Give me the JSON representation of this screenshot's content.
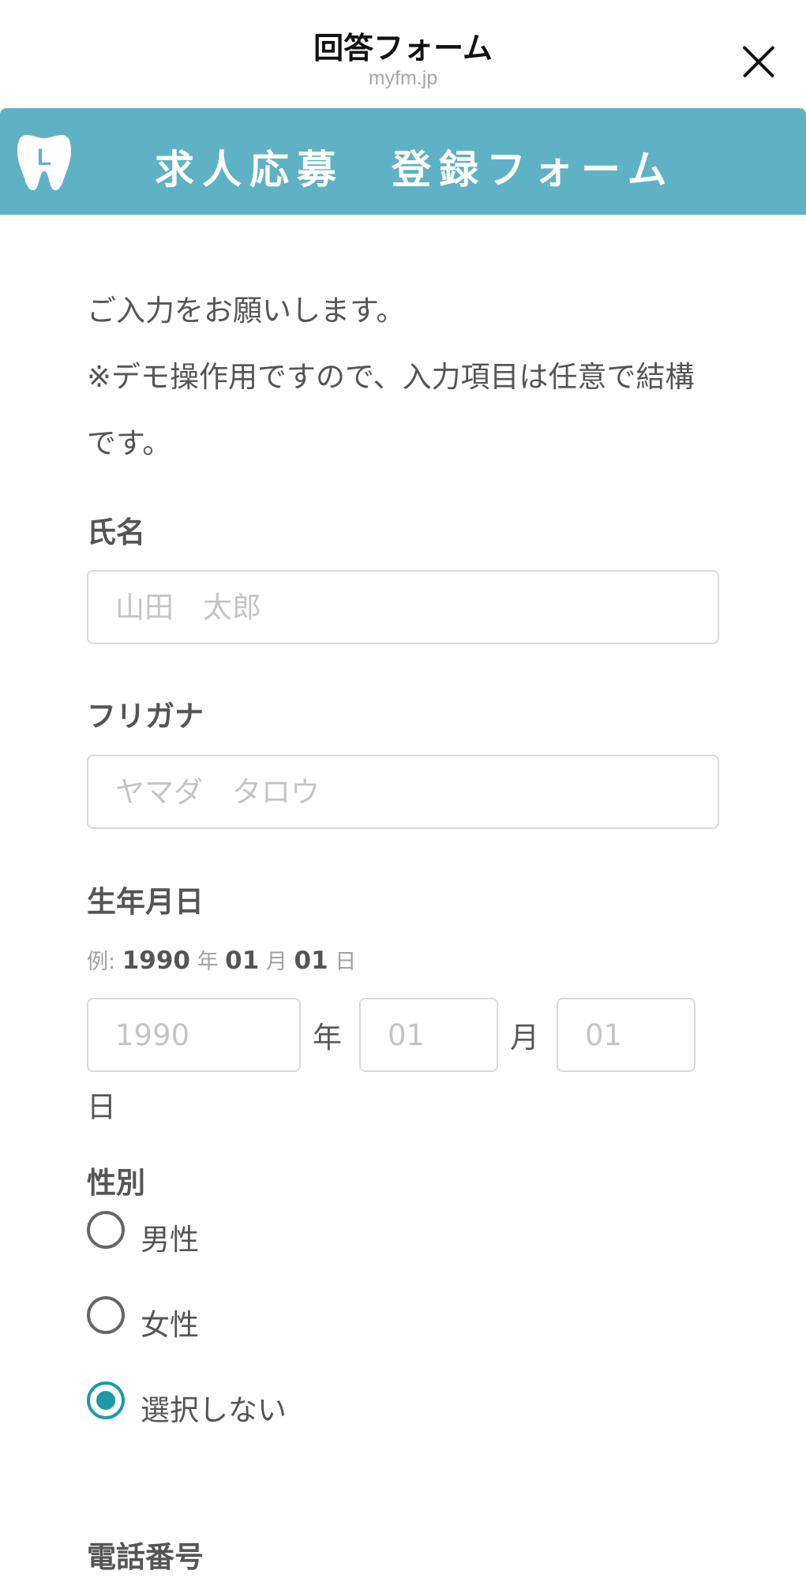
{
  "header": {
    "title": "回答フォーム",
    "domain": "myfm.jp",
    "close_icon": "close-icon"
  },
  "banner": {
    "logo_icon": "tooth-logo-icon",
    "logo_letter": "L",
    "title": "求人応募　登録フォーム",
    "color": "#5fb2c4"
  },
  "intro": {
    "line1": "ご入力をお願いします。",
    "line2": "※デモ操作用ですので、入力項目は任意で結構です。"
  },
  "fields": {
    "name": {
      "label": "氏名",
      "value": "",
      "placeholder": "山田　太郎"
    },
    "furigana": {
      "label": "フリガナ",
      "value": "",
      "placeholder": "ヤマダ　タロウ"
    },
    "birthdate": {
      "label": "生年月日",
      "example_prefix": "例:",
      "example_year": "1990",
      "example_year_unit": "年",
      "example_month": "01",
      "example_month_unit": "月",
      "example_day": "01",
      "example_day_unit": "日",
      "year_placeholder": "1990",
      "month_placeholder": "01",
      "day_placeholder": "01",
      "year_unit": "年",
      "month_unit": "月",
      "day_unit": "日"
    },
    "gender": {
      "label": "性別",
      "options": [
        {
          "label": "男性",
          "selected": false
        },
        {
          "label": "女性",
          "selected": false
        },
        {
          "label": "選択しない",
          "selected": true
        }
      ],
      "accent_color": "#1c9aa7"
    },
    "phone": {
      "label": "電話番号"
    }
  }
}
